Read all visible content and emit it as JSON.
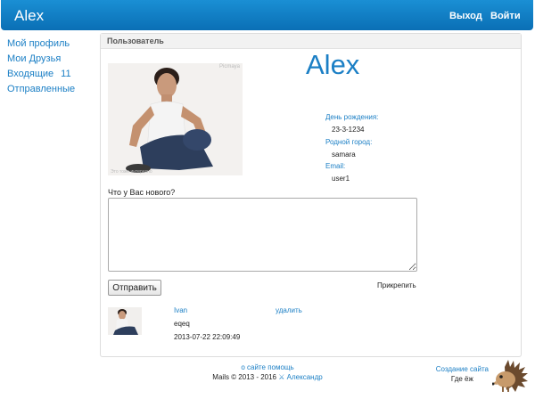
{
  "header": {
    "brand": "Alex",
    "logout": "Выход",
    "login": "Войти"
  },
  "sidebar": {
    "items": [
      {
        "label": "Мой профиль"
      },
      {
        "label": "Мои Друзья"
      },
      {
        "label": "Входящие",
        "count": "11"
      },
      {
        "label": "Отправленные"
      }
    ]
  },
  "panel": {
    "title": "Пользователь"
  },
  "profile": {
    "name": "Alex",
    "photo_tag": "Picmaya",
    "photo_caption": "Это тоже интересно",
    "birthday_label": "День рождения:",
    "birthday": "23-3-1234",
    "city_label": "Родной город:",
    "city": "samara",
    "email_label": "Email:",
    "email": "user1"
  },
  "status": {
    "question": "Что у Вас нового?",
    "value": "",
    "send_label": "Отправить",
    "attach_label": "Прикрепить"
  },
  "posts": [
    {
      "author": "Ivan",
      "delete_label": "удалить",
      "text": "eqeq",
      "date": "2013-07-22 22:09:49"
    }
  ],
  "footer": {
    "about": "о сайте",
    "help": "помощь",
    "copyright": "Mails © 2013 - 2016",
    "author_mark": "⚔",
    "author": "Александр",
    "creation": "Создание сайта",
    "where": "Где ёж"
  },
  "colors": {
    "accent": "#1b7fc5",
    "header": "#0a7bc4"
  },
  "icons": {
    "hedgehog": "hedgehog-icon",
    "user_photo": "profile-photo"
  }
}
